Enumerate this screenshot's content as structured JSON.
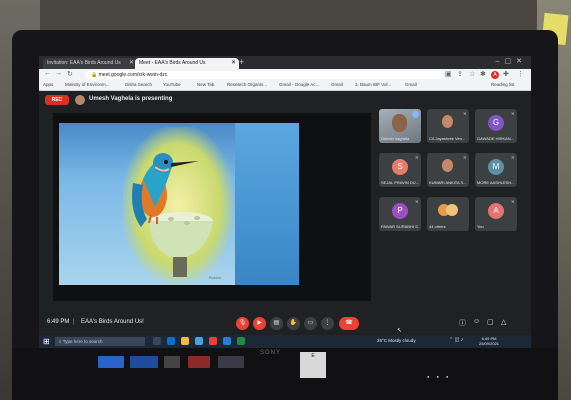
{
  "browser": {
    "tabs": [
      {
        "label": "Invitation: EAA's Birds Around Us"
      },
      {
        "label": "Meet - EAA's Birds Around Us"
      }
    ],
    "url": "meet.google.com/xrk-wwin-dzc",
    "bookmarks": [
      "Apps",
      "Ministry of Environm...",
      "Disha Search",
      "YouTube",
      "New Tab",
      "Research Organis...",
      "Gmail - Google Ac...",
      "Gmail",
      "3. Baum IBF Vol...",
      "Gmail",
      "Reading list"
    ],
    "profile_initial": "A"
  },
  "meet": {
    "rec_label": "REC",
    "presenting_text": "Umesh Vaghela is presenting",
    "slide_credit": "Bubble",
    "side_tag": "Umesh Vaghela",
    "time": "6:49 PM",
    "divider": "|",
    "meeting_name": "EAA's Birds Around Us!",
    "participants": [
      {
        "name": "Umesh Vaghela",
        "initial": "",
        "color": "#8c6248"
      },
      {
        "name": "CA Jayashree Ven...",
        "initial": "",
        "color": "#c28a6a"
      },
      {
        "name": "GAWADE HIRKAN...",
        "initial": "G",
        "color": "#7e57c2"
      },
      {
        "name": "SEJAL PRAVIN DU...",
        "initial": "S",
        "color": "#e57c6b"
      },
      {
        "name": "KUMARI ANKITA S...",
        "initial": "",
        "color": "#c28a6a"
      },
      {
        "name": "MORE AASHLESH...",
        "initial": "M",
        "color": "#5f8fa3"
      },
      {
        "name": "PAWAR SURABHI S...",
        "initial": "P",
        "color": "#9c4fc4"
      },
      {
        "name": "44 others",
        "initial": "",
        "color": "#e39b4c"
      },
      {
        "name": "You",
        "initial": "A",
        "color": "#e57373"
      }
    ]
  },
  "taskbar": {
    "search_placeholder": "Type here to search",
    "weather": "26°C  Mostly cloudy",
    "clock_time": "6:49 PM",
    "clock_date": "25/09/2021"
  },
  "laptop": {
    "brand": "SONY",
    "energy_label": "E"
  }
}
